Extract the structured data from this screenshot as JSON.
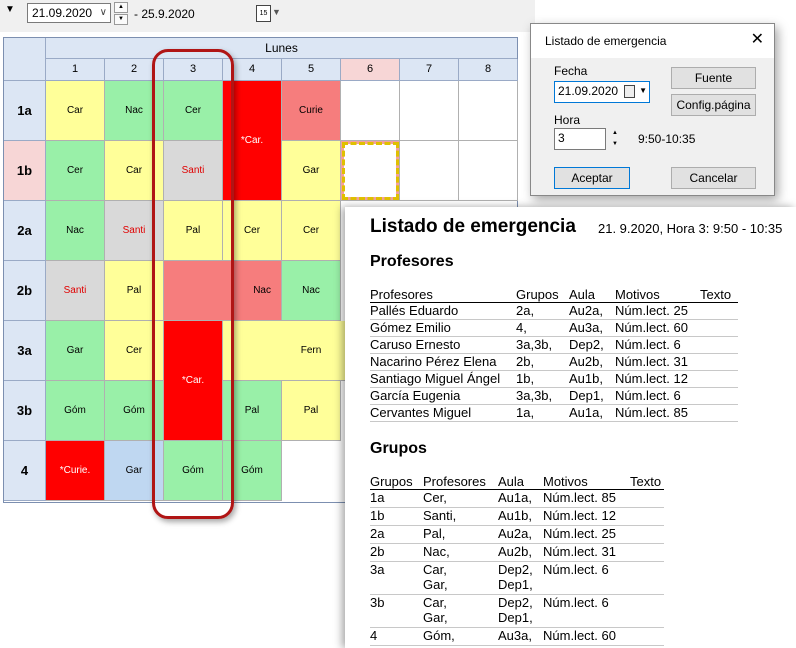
{
  "toolbar": {
    "start_date": "21.09.2020",
    "end_date": "- 25.9.2020",
    "calendar_icon_text": "15"
  },
  "timetable": {
    "day": "Lunes",
    "periods": [
      "1",
      "2",
      "3",
      "4",
      "5",
      "6",
      "7",
      "8"
    ],
    "highlighted_period": "6",
    "rows": [
      "1a",
      "1b",
      "2a",
      "2b",
      "3a",
      "3b",
      "4"
    ],
    "highlighted_row": "1b",
    "cells": {
      "r1a": [
        "Car",
        "Nac",
        "Cer",
        "*Car.",
        "Curie"
      ],
      "r1b": [
        "Cer",
        "Car",
        "Santi",
        "Gar"
      ],
      "r2a": [
        "Nac",
        "Santi",
        "Pal",
        "Cer",
        "Cer"
      ],
      "r2b": [
        "Santi",
        "Pal",
        "Nac",
        "Nac"
      ],
      "r3a": [
        "Gar",
        "Cer",
        "*Car.",
        "Fern"
      ],
      "r3b": [
        "Góm",
        "Góm",
        "Pal",
        "Pal"
      ],
      "r4": [
        "*Curie.",
        "Gar",
        "Góm",
        "Góm"
      ]
    }
  },
  "dialog": {
    "title": "Listado de emergencia",
    "date_label": "Fecha",
    "date_value": "21.09.2020",
    "hour_label": "Hora",
    "hour_value": "3",
    "time_range": "9:50-10:35",
    "font_button": "Fuente",
    "page_setup_button": "Config.página",
    "ok_button": "Aceptar",
    "cancel_button": "Cancelar"
  },
  "report": {
    "title": "Listado de emergencia",
    "subtitle": "21. 9.2020, Hora 3: 9:50 - 10:35",
    "teachers_section": "Profesores",
    "teachers_headers": [
      "Profesores",
      "Grupos",
      "Aula",
      "Motivos",
      "Texto"
    ],
    "teachers_rows": [
      [
        "Pallés Eduardo",
        "2a,",
        "Au2a,",
        "Núm.lect. 25"
      ],
      [
        "Gómez Emilio",
        "4,",
        "Au3a,",
        "Núm.lect. 60"
      ],
      [
        "Caruso Ernesto",
        "3a,3b,",
        "Dep2,",
        "Núm.lect. 6"
      ],
      [
        "Nacarino Pérez Elena",
        "2b,",
        "Au2b,",
        "Núm.lect. 31"
      ],
      [
        "Santiago Miguel Ángel",
        "1b,",
        "Au1b,",
        "Núm.lect. 12"
      ],
      [
        "García Eugenia",
        "3a,3b,",
        "Dep1,",
        "Núm.lect. 6"
      ],
      [
        "Cervantes  Miguel",
        "1a,",
        "Au1a,",
        "Núm.lect. 85"
      ]
    ],
    "groups_section": "Grupos",
    "groups_headers": [
      "Grupos",
      "Profesores",
      "Aula",
      "Motivos",
      "Texto"
    ],
    "groups_rows": [
      [
        "1a",
        "Cer,",
        "Au1a,",
        "Núm.lect. 85"
      ],
      [
        "1b",
        "Santi,",
        "Au1b,",
        "Núm.lect. 12"
      ],
      [
        "2a",
        "Pal,",
        "Au2a,",
        "Núm.lect. 25"
      ],
      [
        "2b",
        "Nac,",
        "Au2b,",
        "Núm.lect. 31"
      ],
      [
        "3a",
        "Car,\nGar,",
        "Dep2,\nDep1,",
        "Núm.lect. 6"
      ],
      [
        "3b",
        "Car,\nGar,",
        "Dep2,\nDep1,",
        "Núm.lect. 6"
      ],
      [
        "4",
        "Góm,",
        "Au3a,",
        "Núm.lect. 60"
      ]
    ]
  }
}
